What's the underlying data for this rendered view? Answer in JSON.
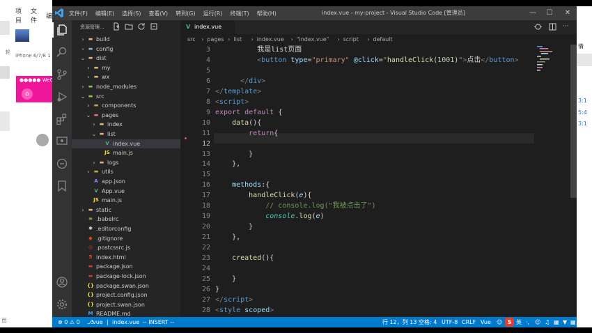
{
  "left_app": {
    "menu": [
      "项目",
      "文件",
      "编"
    ],
    "device": "iPhone 6/7/8 1",
    "side_char": "轮",
    "phone_status": "●●●●● WeCh",
    "home_icon": "⌂",
    "bottom_text": "页"
  },
  "titlebar": {
    "menu": [
      "文件(F)",
      "编辑(E)",
      "选择(S)",
      "查看(V)",
      "转到(G)",
      "运行(R)",
      "终端(T)",
      "帮助(H)"
    ],
    "title": "index.vue - my-project - Visual Studio Code [管理员]",
    "minimize": "—",
    "maximize": "☐",
    "close": "✕"
  },
  "sidebar": {
    "title": "资源管理...",
    "tree": [
      {
        "name": "build",
        "chev": ">",
        "indent": 0,
        "icon": "folder",
        "color": "#dcb67a"
      },
      {
        "name": "config",
        "chev": ">",
        "indent": 0,
        "icon": "folder-config",
        "color": "#8ab4d8"
      },
      {
        "name": "dist",
        "chev": "v",
        "indent": 0,
        "icon": "folder",
        "color": "#dcb67a"
      },
      {
        "name": "my",
        "chev": ">",
        "indent": 1,
        "icon": "folder",
        "color": "#dcb67a"
      },
      {
        "name": "wx",
        "chev": ">",
        "indent": 1,
        "icon": "folder",
        "color": "#dcb67a"
      },
      {
        "name": "node_modules",
        "chev": ">",
        "indent": 0,
        "icon": "folder",
        "color": "#8bc34a"
      },
      {
        "name": "src",
        "chev": "v",
        "indent": 0,
        "icon": "folder-src",
        "color": "#8bc34a"
      },
      {
        "name": "components",
        "chev": ">",
        "indent": 1,
        "icon": "folder",
        "color": "#c5a84b"
      },
      {
        "name": "pages",
        "chev": "v",
        "indent": 1,
        "icon": "folder-pages",
        "color": "#e57373"
      },
      {
        "name": "index",
        "chev": ">",
        "indent": 2,
        "icon": "folder",
        "color": "#dcb67a"
      },
      {
        "name": "list",
        "chev": "v",
        "indent": 2,
        "icon": "folder",
        "color": "#dcb67a"
      },
      {
        "name": "index.vue",
        "chev": "",
        "indent": 3,
        "icon": "vue",
        "color": "#41b883",
        "selected": true
      },
      {
        "name": "main.js",
        "chev": "",
        "indent": 3,
        "icon": "js",
        "color": "#f1dd35"
      },
      {
        "name": "logs",
        "chev": ">",
        "indent": 2,
        "icon": "folder",
        "color": "#dcb67a"
      },
      {
        "name": "utils",
        "chev": ">",
        "indent": 1,
        "icon": "folder-utils",
        "color": "#c5a84b"
      },
      {
        "name": "app.json",
        "chev": "",
        "indent": 1,
        "icon": "json",
        "color": "#8a8aff"
      },
      {
        "name": "App.vue",
        "chev": "",
        "indent": 1,
        "icon": "vue",
        "color": "#41b883"
      },
      {
        "name": "main.js",
        "chev": "",
        "indent": 1,
        "icon": "js",
        "color": "#f1dd35"
      },
      {
        "name": "static",
        "chev": ">",
        "indent": 0,
        "icon": "folder",
        "color": "#dcb67a"
      },
      {
        "name": ".babelrc",
        "chev": "",
        "indent": 0,
        "icon": "babel",
        "color": "#f5da55"
      },
      {
        "name": ".editorconfig",
        "chev": "",
        "indent": 0,
        "icon": "editorconfig",
        "color": "#ddd"
      },
      {
        "name": ".gitignore",
        "chev": "",
        "indent": 0,
        "icon": "git",
        "color": "#e64a19"
      },
      {
        "name": ".postcssrc.js",
        "chev": "",
        "indent": 0,
        "icon": "postcss",
        "color": "#dd3735"
      },
      {
        "name": "index.html",
        "chev": "",
        "indent": 0,
        "icon": "html",
        "color": "#e44d26"
      },
      {
        "name": "package.json",
        "chev": "",
        "indent": 0,
        "icon": "npm",
        "color": "#cb3837"
      },
      {
        "name": "package-lock.json",
        "chev": "",
        "indent": 0,
        "icon": "npm",
        "color": "#cb3837"
      },
      {
        "name": "package.swan.json",
        "chev": "",
        "indent": 0,
        "icon": "json-braces",
        "color": "#f1dd35"
      },
      {
        "name": "project.config.json",
        "chev": "",
        "indent": 0,
        "icon": "json-braces",
        "color": "#f1dd35"
      },
      {
        "name": "project.swan.json",
        "chev": "",
        "indent": 0,
        "icon": "json-braces",
        "color": "#f1dd35"
      },
      {
        "name": "README.md",
        "chev": "",
        "indent": 0,
        "icon": "markdown",
        "color": "#42a5f5"
      }
    ]
  },
  "editor": {
    "tab_label": "index.vue",
    "tab_icon": "V",
    "breadcrumb": [
      "src",
      "pages",
      "list",
      "index.vue",
      "\"index.vue\"",
      "script",
      "default"
    ],
    "active_line": "12",
    "lines": [
      {
        "n": "3",
        "tokens": [
          [
            "w",
            "          我是list页面"
          ]
        ]
      },
      {
        "n": "4",
        "tokens": [
          [
            "tag",
            "          <"
          ],
          [
            "t",
            "button"
          ],
          [
            "a",
            " type"
          ],
          [
            "w",
            "="
          ],
          [
            "s",
            "\"primary\""
          ],
          [
            "a",
            " @click"
          ],
          [
            "w",
            "="
          ],
          [
            "s",
            "\""
          ],
          [
            "f",
            "handleClick"
          ],
          [
            "w",
            "("
          ],
          [
            "n",
            "1001"
          ],
          [
            "w",
            ")"
          ],
          [
            "s",
            "\""
          ],
          [
            "tag",
            ">"
          ],
          [
            "w",
            "点击"
          ],
          [
            "tag",
            "</"
          ],
          [
            "t",
            "button"
          ],
          [
            "tag",
            ">"
          ]
        ]
      },
      {
        "n": "5",
        "tokens": []
      },
      {
        "n": "6",
        "tokens": [
          [
            "tag",
            "      </"
          ],
          [
            "t",
            "div"
          ],
          [
            "tag",
            ">"
          ]
        ]
      },
      {
        "n": "7",
        "tokens": [
          [
            "tag",
            "</"
          ],
          [
            "t",
            "template"
          ],
          [
            "tag",
            ">"
          ]
        ]
      },
      {
        "n": "8",
        "tokens": [
          [
            "tag",
            "<"
          ],
          [
            "t",
            "script"
          ],
          [
            "tag",
            ">"
          ]
        ]
      },
      {
        "n": "9",
        "tokens": [
          [
            "k",
            "export"
          ],
          [
            "k",
            " default"
          ],
          [
            "w",
            " {"
          ]
        ]
      },
      {
        "n": "10",
        "tokens": [
          [
            "f",
            "    data"
          ],
          [
            "w",
            "(){"
          ]
        ]
      },
      {
        "n": "11",
        "tokens": [
          [
            "k",
            "        return"
          ],
          [
            "w",
            "{"
          ]
        ]
      },
      {
        "n": "12",
        "tokens": [
          [
            "w",
            "        "
          ]
        ]
      },
      {
        "n": "13",
        "tokens": [
          [
            "w",
            "        }"
          ]
        ]
      },
      {
        "n": "14",
        "tokens": [
          [
            "w",
            "    },"
          ]
        ]
      },
      {
        "n": "15",
        "tokens": []
      },
      {
        "n": "16",
        "tokens": [
          [
            "a",
            "    methods"
          ],
          [
            "w",
            ":{"
          ]
        ]
      },
      {
        "n": "17",
        "tokens": [
          [
            "f",
            "        handleClick"
          ],
          [
            "w",
            "("
          ],
          [
            "a",
            "e"
          ],
          [
            "w",
            "){"
          ]
        ]
      },
      {
        "n": "18",
        "tokens": [
          [
            "c",
            "            // console.log(\"我被点击了\")"
          ]
        ]
      },
      {
        "n": "19",
        "tokens": [
          [
            "o",
            "            console"
          ],
          [
            "w",
            "."
          ],
          [
            "f",
            "log"
          ],
          [
            "w",
            "("
          ],
          [
            "a",
            "e"
          ],
          [
            "w",
            ")"
          ]
        ]
      },
      {
        "n": "20",
        "tokens": [
          [
            "w",
            "        }"
          ]
        ]
      },
      {
        "n": "21",
        "tokens": [
          [
            "w",
            "    },"
          ]
        ]
      },
      {
        "n": "22",
        "tokens": []
      },
      {
        "n": "23",
        "tokens": [
          [
            "f",
            "    created"
          ],
          [
            "w",
            "(){"
          ]
        ]
      },
      {
        "n": "24",
        "tokens": []
      },
      {
        "n": "25",
        "tokens": [
          [
            "w",
            "    }"
          ]
        ]
      },
      {
        "n": "26",
        "tokens": [
          [
            "w",
            "}"
          ]
        ]
      },
      {
        "n": "27",
        "tokens": [
          [
            "tag",
            "</"
          ],
          [
            "t",
            "script"
          ],
          [
            "tag",
            ">"
          ]
        ]
      },
      {
        "n": "28",
        "tokens": [
          [
            "tag",
            "<"
          ],
          [
            "t",
            "style"
          ],
          [
            "a",
            " scoped"
          ],
          [
            "tag",
            ">"
          ]
        ]
      }
    ]
  },
  "statusbar": {
    "errors": "⊗ 0 ⚠ 0",
    "branch": "vue",
    "file": "index.vue",
    "mode": "-- INSERT --",
    "position": "行 12，列 13",
    "spaces": "空格: 4",
    "encoding": "UTF-8",
    "eol": "CRLF",
    "language": "Vue"
  },
  "right_strip": {
    "texts": [
      "倩",
      "3:1",
      "5:4",
      "3:1"
    ]
  },
  "ime": {
    "logo": "S",
    "label": "英"
  }
}
